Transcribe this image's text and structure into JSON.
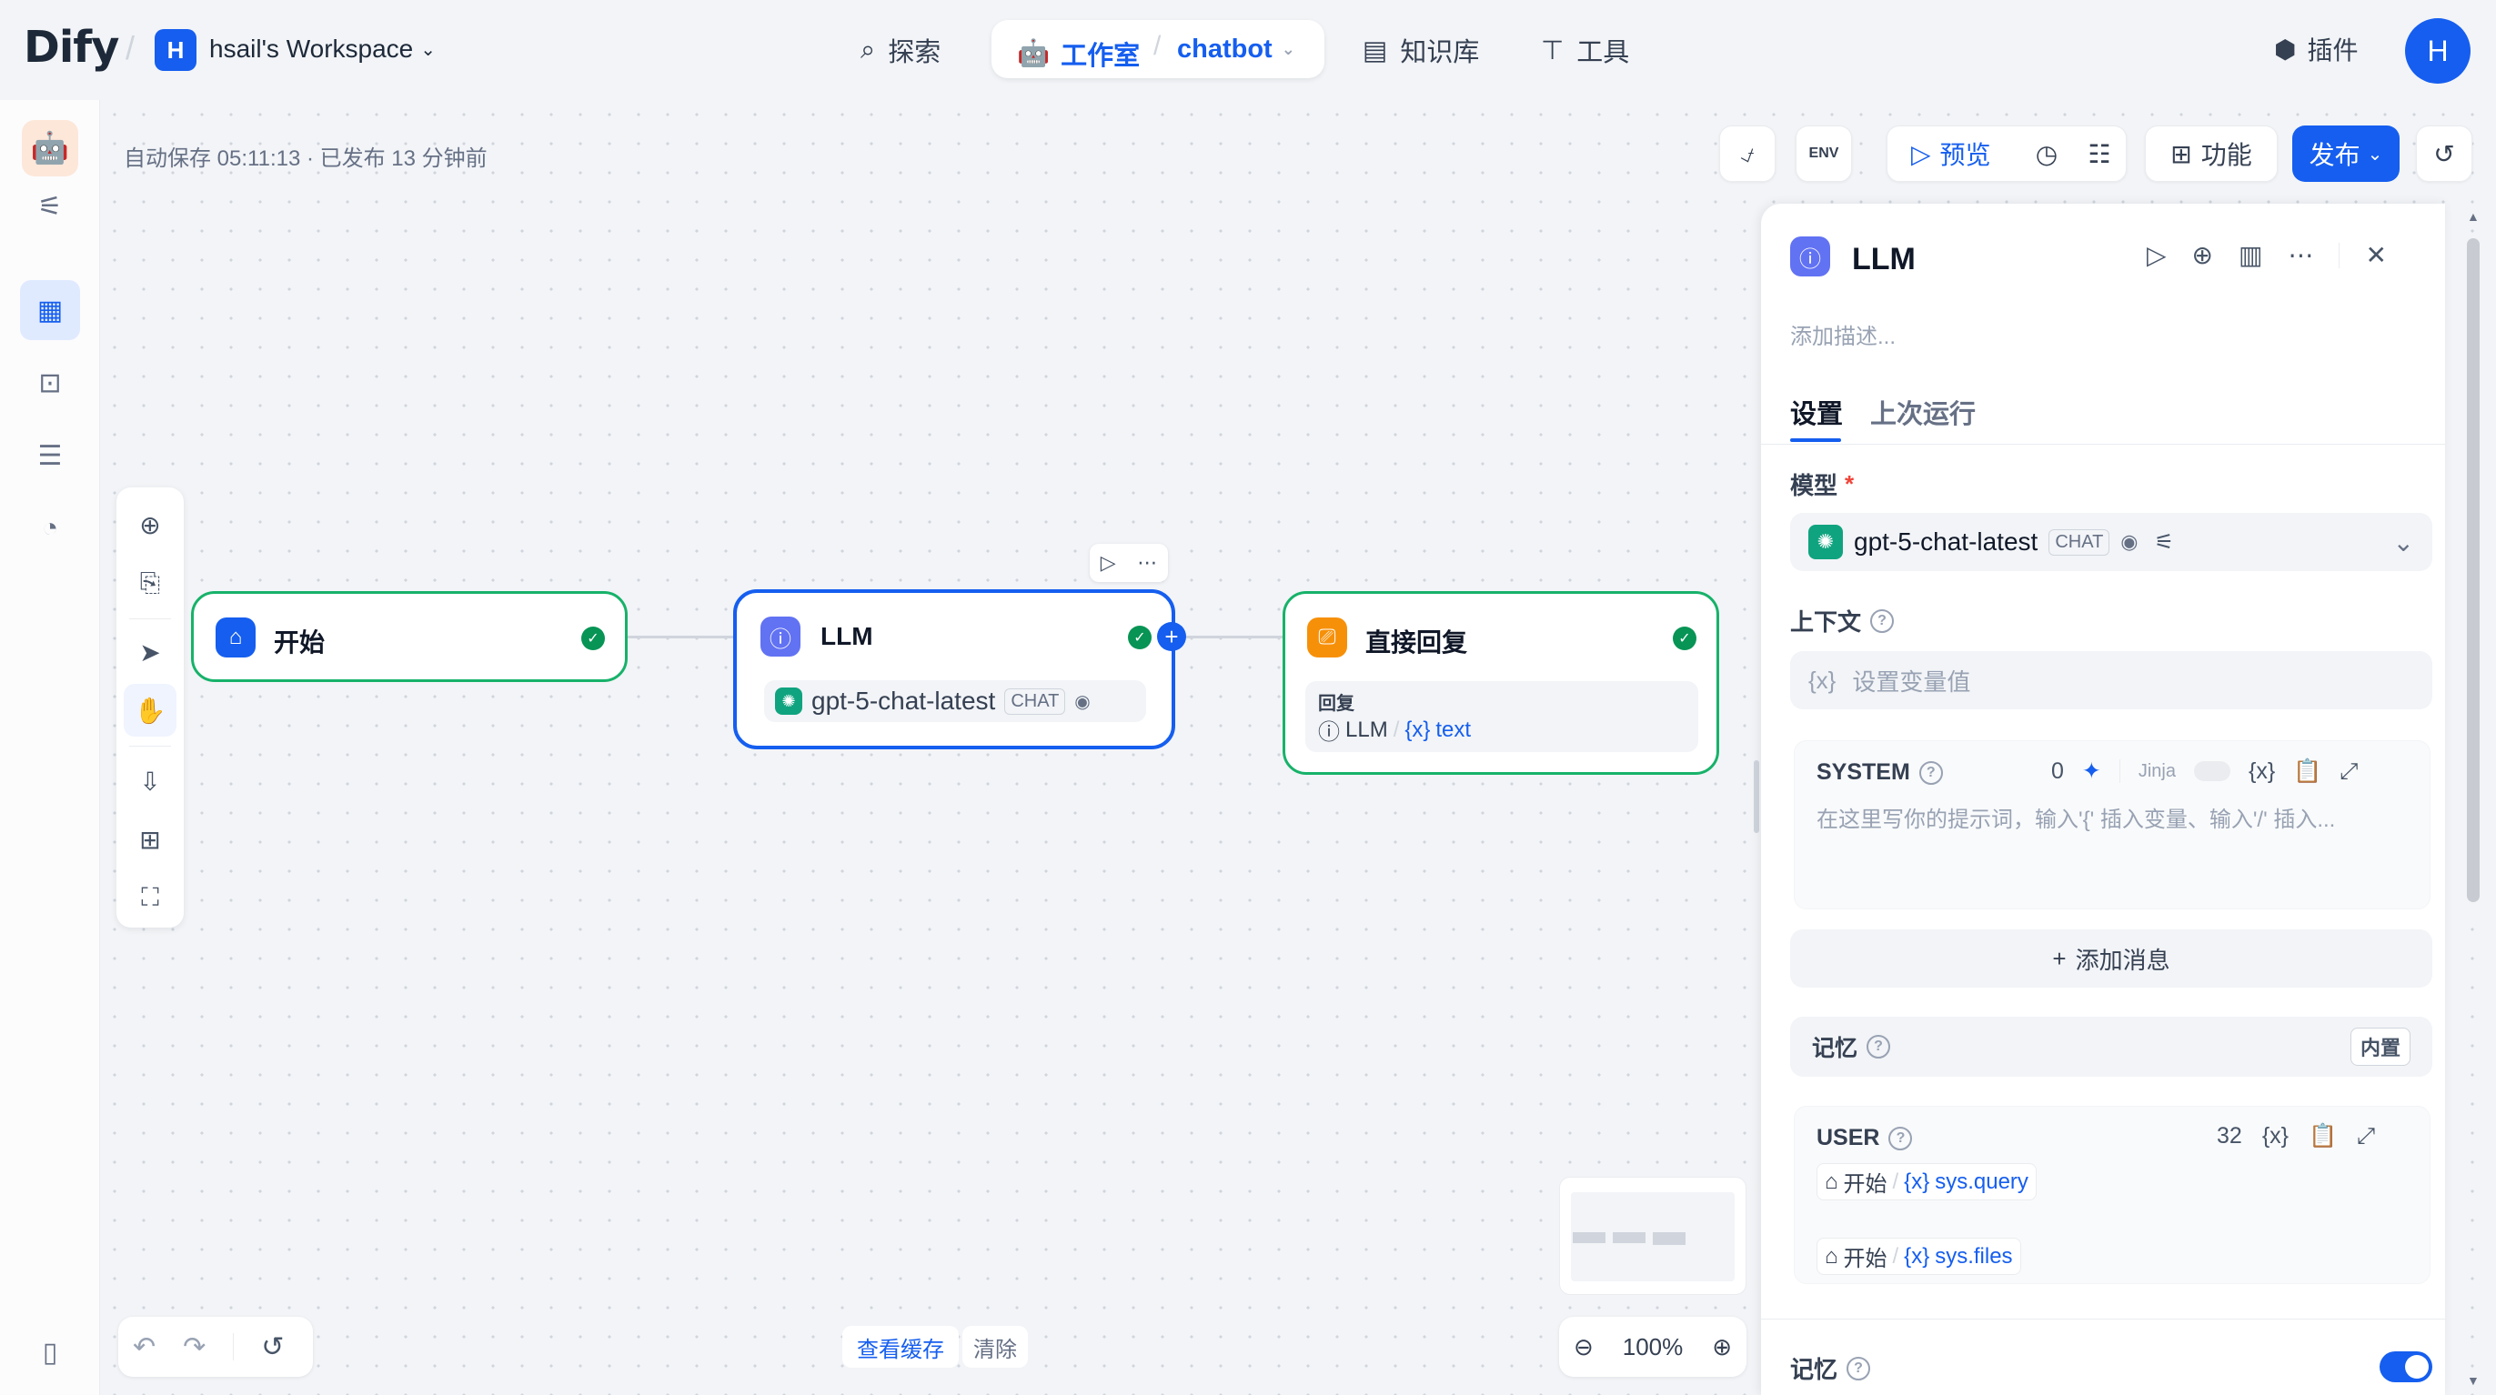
{
  "brand": {
    "logo": "Dify"
  },
  "workspace": {
    "initial": "H",
    "name": "hsail's Workspace"
  },
  "nav": {
    "explore": "探索",
    "studio": "工作室",
    "app_name": "chatbot",
    "knowledge": "知识库",
    "tools": "工具",
    "plugins": "插件",
    "user_initial": "H"
  },
  "status": {
    "autosave": "自动保存 05:11:13 · 已发布 13 分钟前"
  },
  "toolbar": {
    "preview": "预览",
    "features": "功能",
    "publish": "发布",
    "env": "ENV"
  },
  "nodes": {
    "start": {
      "title": "开始"
    },
    "llm": {
      "title": "LLM",
      "model": "gpt-5-chat-latest",
      "mode": "CHAT"
    },
    "reply": {
      "title": "直接回复",
      "label": "回复",
      "src_node": "LLM",
      "src_var": "text"
    }
  },
  "bottom": {
    "view_cache": "查看缓存",
    "clear": "清除",
    "zoom": "100%"
  },
  "panel": {
    "title": "LLM",
    "desc_placeholder": "添加描述...",
    "tabs": {
      "settings": "设置",
      "last_run": "上次运行"
    },
    "model_label": "模型",
    "required": "*",
    "model": "gpt-5-chat-latest",
    "model_mode": "CHAT",
    "context_label": "上下文",
    "context_placeholder": "设置变量值",
    "system": {
      "label": "SYSTEM",
      "count": "0",
      "jinja": "Jinja",
      "placeholder": "在这里写你的提示词，输入'{' 插入变量、输入'/' 插入..."
    },
    "add_message": "添加消息",
    "memory_label": "记忆",
    "memory_badge": "内置",
    "user": {
      "label": "USER",
      "count": "32",
      "var1_node": "开始",
      "var1": "sys.query",
      "var2_node": "开始",
      "var2": "sys.files"
    },
    "memory2_label": "记忆"
  },
  "colors": {
    "accent": "#155eef",
    "success": "#079455",
    "start_border": "#17b26a",
    "reply_icon": "#f79009"
  }
}
